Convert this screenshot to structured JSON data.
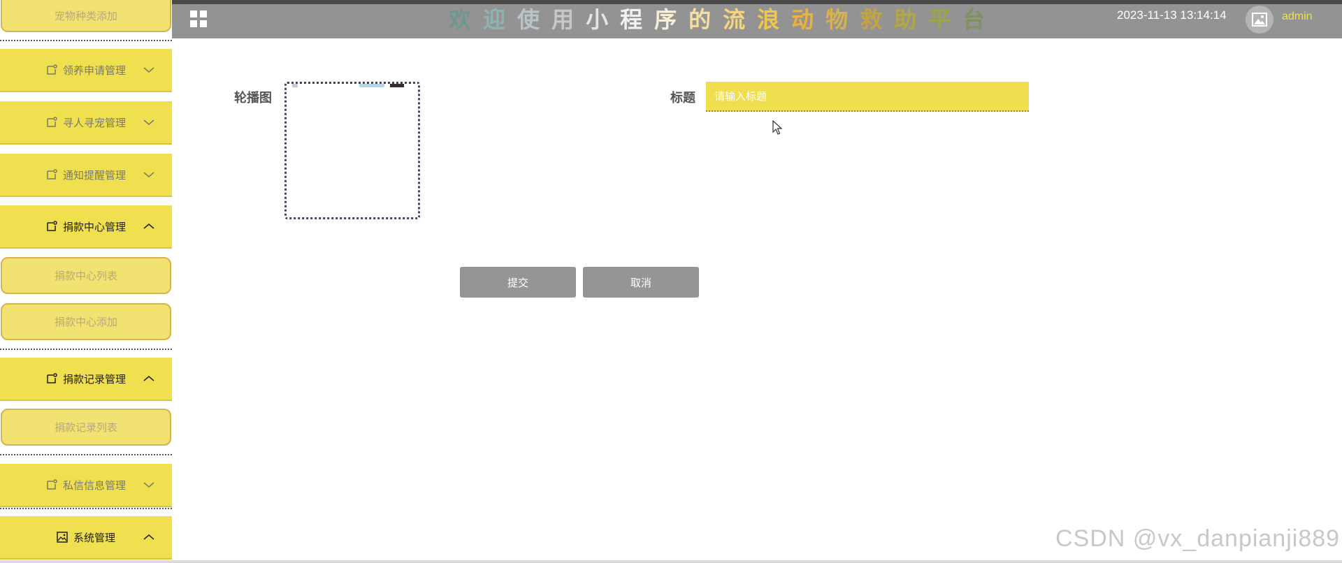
{
  "header": {
    "title": "欢迎使用小程序的流浪动物救助平台",
    "title_colors": [
      "#6e968e",
      "#8fb3b3",
      "#b7c4c8",
      "#c7c7c7",
      "#e4e4e4",
      "#f1f1f1",
      "#f6f0d8",
      "#f5dfa0",
      "#f2d680",
      "#f0c74b",
      "#eab23f",
      "#d9b14f",
      "#c3a445",
      "#b2a743",
      "#9fa349",
      "#7f9061"
    ],
    "datetime": "2023-11-13 13:14:14",
    "username": "admin"
  },
  "sidebar": {
    "items": [
      {
        "type": "sub",
        "label": "宠物种类添加"
      },
      {
        "type": "main",
        "label": "领养申请管理",
        "expanded": false,
        "active": false
      },
      {
        "type": "main",
        "label": "寻人寻宠管理",
        "expanded": false,
        "active": false
      },
      {
        "type": "main",
        "label": "通知提醒管理",
        "expanded": false,
        "active": false
      },
      {
        "type": "main",
        "label": "捐款中心管理",
        "expanded": true,
        "active": true
      },
      {
        "type": "sub",
        "label": "捐款中心列表"
      },
      {
        "type": "sub",
        "label": "捐款中心添加"
      },
      {
        "type": "main",
        "label": "捐款记录管理",
        "expanded": true,
        "active": true
      },
      {
        "type": "sub",
        "label": "捐款记录列表"
      },
      {
        "type": "main",
        "label": "私信信息管理",
        "expanded": false,
        "active": false
      },
      {
        "type": "main",
        "label": "系统管理",
        "expanded": true,
        "active": true,
        "icon": "image-icon"
      }
    ]
  },
  "form": {
    "carousel_label": "轮播图",
    "title_label": "标题",
    "title_placeholder": "请输入标题",
    "submit_label": "提交",
    "cancel_label": "取消"
  },
  "watermark": "CSDN @vx_danpianji889",
  "colors": {
    "accent_yellow": "#f0df4f",
    "header_gray": "#939393",
    "button_gray": "#959595"
  }
}
